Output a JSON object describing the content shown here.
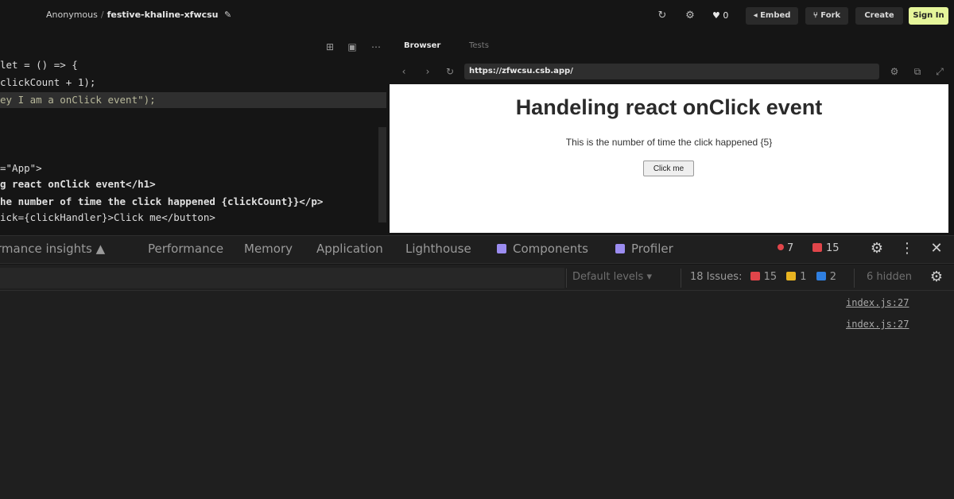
{
  "topbar": {
    "user": "Anonymous",
    "separator": "/",
    "project": "festive-khaline-xfwcsu",
    "likes": "0",
    "embed_label": "Embed",
    "fork_label": "Fork",
    "create_label": "Create",
    "signin_label": "Sign In"
  },
  "editor": {
    "lines": [
      {
        "text": "let = () => {"
      },
      {
        "text": "clickCount + 1);"
      },
      {
        "text": "ey I am a onClick event\");"
      },
      {
        "text": "=\"App\">"
      },
      {
        "text": "g react onClick event</h1>"
      },
      {
        "text": "he number of time the click happened {clickCount}}</p>"
      },
      {
        "text": "ick={clickHandler}>Click me</button>"
      }
    ]
  },
  "preview_panel": {
    "tab_browser": "Browser",
    "tab_tests": "Tests",
    "url": "https://zfwcsu.csb.app/"
  },
  "app": {
    "heading": "Handeling react onClick event",
    "message": "This is the number of time the click happened {5}",
    "button_label": "Click me"
  },
  "devtools": {
    "tabs": [
      {
        "label": "rmance insights ▲",
        "icon": "none"
      },
      {
        "label": "Performance",
        "icon": "none"
      },
      {
        "label": "Memory",
        "icon": "none"
      },
      {
        "label": "Application",
        "icon": "none"
      },
      {
        "label": "Lighthouse",
        "icon": "none"
      },
      {
        "label": "Components",
        "icon": "react-square-icon"
      },
      {
        "label": "Profiler",
        "icon": "react-square-icon"
      }
    ],
    "errors": "7",
    "warnings": "15",
    "default_levels": "Default levels ▾",
    "issues_label": "18 Issues:",
    "issues_red": "15",
    "issues_yellow": "1",
    "issues_blue": "2",
    "hidden": "6 hidden",
    "colors": {
      "red": "#e0454a",
      "yellow": "#e8b421",
      "blue": "#2f7fe0"
    }
  },
  "console": {
    "links": [
      "index.js:27",
      "index.js:27"
    ]
  }
}
